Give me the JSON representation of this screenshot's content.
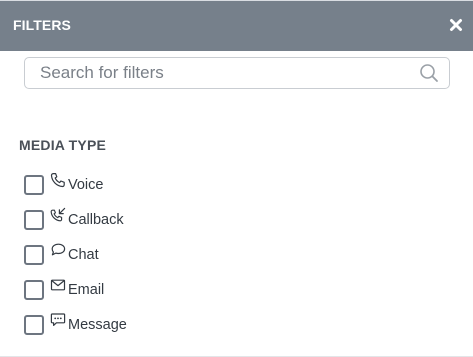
{
  "header": {
    "title": "FILTERS",
    "close_icon": "close-icon"
  },
  "search": {
    "placeholder": "Search for filters",
    "value": "",
    "icon": "search-icon"
  },
  "media_type": {
    "title": "MEDIA TYPE",
    "options": [
      {
        "label": "Voice",
        "icon": "phone-icon",
        "checked": false
      },
      {
        "label": "Callback",
        "icon": "callback-icon",
        "checked": false
      },
      {
        "label": "Chat",
        "icon": "chat-bubble-icon",
        "checked": false
      },
      {
        "label": "Email",
        "icon": "envelope-icon",
        "checked": false
      },
      {
        "label": "Message",
        "icon": "message-icon",
        "checked": false
      }
    ]
  },
  "colors": {
    "header_bg": "#76808b",
    "header_text": "#ffffff",
    "checkbox_border": "#6d7580",
    "text": "#333a42"
  }
}
